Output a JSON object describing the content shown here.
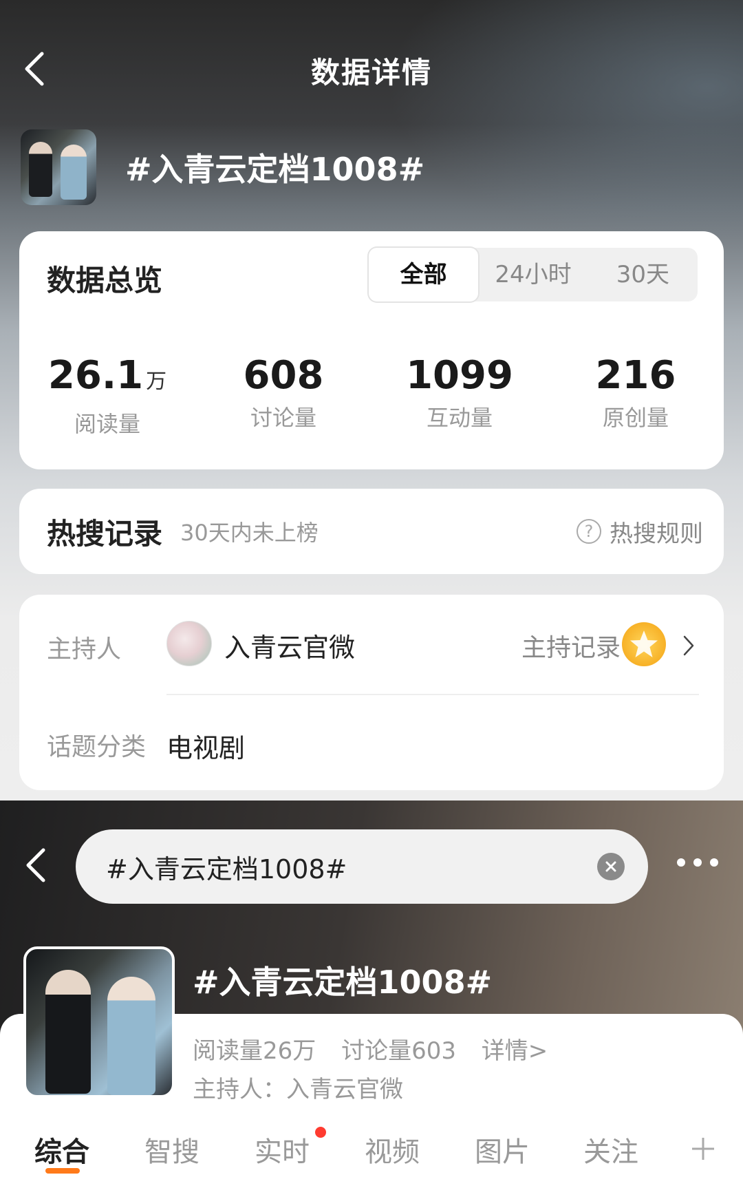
{
  "top": {
    "nav_title": "数据详情",
    "topic_title": "#入青云定档1008#",
    "overview": {
      "title": "数据总览",
      "tabs": [
        "全部",
        "24小时",
        "30天"
      ],
      "active_tab": "全部",
      "stats": [
        {
          "value": "26.1",
          "unit": "万",
          "label": "阅读量"
        },
        {
          "value": "608",
          "unit": "",
          "label": "讨论量"
        },
        {
          "value": "1099",
          "unit": "",
          "label": "互动量"
        },
        {
          "value": "216",
          "unit": "",
          "label": "原创量"
        }
      ]
    },
    "hot_search": {
      "title": "热搜记录",
      "subtitle": "30天内未上榜",
      "rules_label": "热搜规则"
    },
    "info": {
      "host_label": "主持人",
      "host_name": "入青云官微",
      "host_record_label": "主持记录",
      "category_label": "话题分类",
      "category_value": "电视剧"
    }
  },
  "bottom": {
    "search_text": "#入青云定档1008#",
    "topic_title": "#入青云定档1008#",
    "reads": "阅读量26万",
    "discussions": "讨论量603",
    "details_link": "详情>",
    "host_line": "主持人：入青云官微",
    "tabs": [
      "综合",
      "智搜",
      "实时",
      "视频",
      "图片",
      "关注"
    ],
    "active_tab": "综合"
  },
  "colors": {
    "accent": "#ff7a1a",
    "notify_dot": "#ff3b30",
    "badge": "#f7b127"
  },
  "icons": [
    "back-chevron-icon",
    "question-circle-icon",
    "chevron-right-icon",
    "clear-x-icon",
    "more-dots-icon",
    "plus-icon",
    "star-badge-icon"
  ]
}
